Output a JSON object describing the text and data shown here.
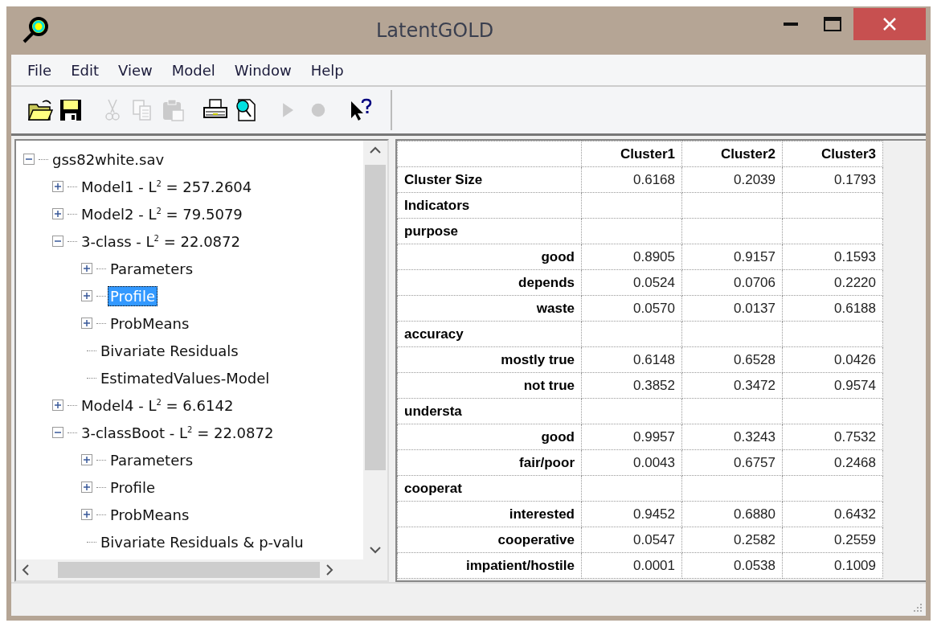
{
  "window": {
    "title": "LatentGOLD"
  },
  "menu": [
    "File",
    "Edit",
    "View",
    "Model",
    "Window",
    "Help"
  ],
  "toolbar": [
    {
      "kind": "open",
      "disabled": false
    },
    {
      "kind": "save",
      "disabled": false
    },
    {
      "kind": "sep"
    },
    {
      "kind": "cut",
      "disabled": true
    },
    {
      "kind": "copy",
      "disabled": true
    },
    {
      "kind": "paste",
      "disabled": true
    },
    {
      "kind": "sep"
    },
    {
      "kind": "print",
      "disabled": false
    },
    {
      "kind": "preview",
      "disabled": false
    },
    {
      "kind": "sep"
    },
    {
      "kind": "run",
      "disabled": true
    },
    {
      "kind": "stop",
      "disabled": true
    },
    {
      "kind": "sep"
    },
    {
      "kind": "help",
      "disabled": false
    }
  ],
  "tree": [
    {
      "label": "gss82white.sav",
      "kind": "branch",
      "expanded": true,
      "selected": false,
      "children": [
        {
          "label": "Model1 - L$^{2}$ = 257.2604",
          "kind": "branch",
          "expanded": false,
          "selected": false
        },
        {
          "label": "Model2 - L$^{2}$ = 79.5079",
          "kind": "branch",
          "expanded": false,
          "selected": false
        },
        {
          "label": "3-class - L$^{2}$ = 22.0872",
          "kind": "branch",
          "expanded": true,
          "selected": false,
          "children": [
            {
              "label": "Parameters",
              "kind": "branch",
              "expanded": false,
              "selected": false
            },
            {
              "label": "Profile",
              "kind": "branch",
              "expanded": false,
              "selected": true
            },
            {
              "label": "ProbMeans",
              "kind": "branch",
              "expanded": false,
              "selected": false
            },
            {
              "label": "Bivariate Residuals",
              "kind": "leaf",
              "selected": false
            },
            {
              "label": "EstimatedValues-Model",
              "kind": "leaf",
              "selected": false
            }
          ]
        },
        {
          "label": "Model4 - L$^{2}$ = 6.6142",
          "kind": "branch",
          "expanded": false,
          "selected": false
        },
        {
          "label": "3-classBoot - L$^{2}$ = 22.0872",
          "kind": "branch",
          "expanded": true,
          "selected": false,
          "children": [
            {
              "label": "Parameters",
              "kind": "branch",
              "expanded": false,
              "selected": false
            },
            {
              "label": "Profile",
              "kind": "branch",
              "expanded": false,
              "selected": false
            },
            {
              "label": "ProbMeans",
              "kind": "branch",
              "expanded": false,
              "selected": false
            },
            {
              "label": "Bivariate Residuals & p-valu",
              "kind": "leaf",
              "selected": false
            }
          ]
        }
      ]
    }
  ],
  "table": {
    "columns": [
      "Cluster1",
      "Cluster2",
      "Cluster3"
    ],
    "rows": [
      {
        "label": "Cluster Size",
        "kind": "header",
        "values": [
          "0.6168",
          "0.2039",
          "0.1793"
        ]
      },
      {
        "label": "Indicators",
        "kind": "header"
      },
      {
        "label": "purpose",
        "kind": "header"
      },
      {
        "label": "good",
        "kind": "category",
        "values": [
          "0.8905",
          "0.9157",
          "0.1593"
        ]
      },
      {
        "label": "depends",
        "kind": "category",
        "values": [
          "0.0524",
          "0.0706",
          "0.2220"
        ]
      },
      {
        "label": "waste",
        "kind": "category",
        "values": [
          "0.0570",
          "0.0137",
          "0.6188"
        ]
      },
      {
        "label": "accuracy",
        "kind": "header"
      },
      {
        "label": "mostly true",
        "kind": "category",
        "values": [
          "0.6148",
          "0.6528",
          "0.0426"
        ]
      },
      {
        "label": "not true",
        "kind": "category",
        "values": [
          "0.3852",
          "0.3472",
          "0.9574"
        ]
      },
      {
        "label": "understa",
        "kind": "header"
      },
      {
        "label": "good",
        "kind": "category",
        "values": [
          "0.9957",
          "0.3243",
          "0.7532"
        ]
      },
      {
        "label": "fair/poor",
        "kind": "category",
        "values": [
          "0.0043",
          "0.6757",
          "0.2468"
        ]
      },
      {
        "label": "cooperat",
        "kind": "header"
      },
      {
        "label": "interested",
        "kind": "category",
        "values": [
          "0.9452",
          "0.6880",
          "0.6432"
        ]
      },
      {
        "label": "cooperative",
        "kind": "category",
        "values": [
          "0.0547",
          "0.2582",
          "0.2559"
        ]
      },
      {
        "label": "impatient/hostile",
        "kind": "category",
        "values": [
          "0.0001",
          "0.0538",
          "0.1009"
        ]
      }
    ]
  }
}
